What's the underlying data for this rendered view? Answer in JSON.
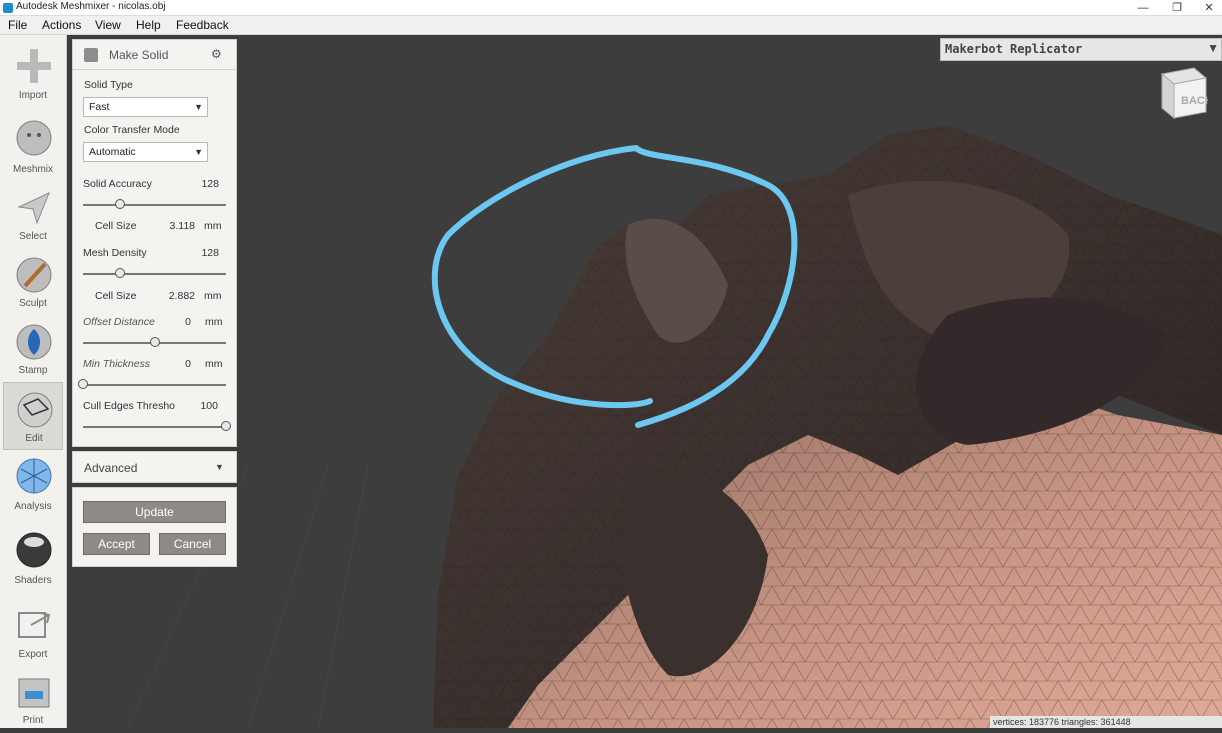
{
  "window": {
    "title": "Autodesk Meshmixer - nicolas.obj",
    "minimize": "—",
    "maximize": "❐",
    "close": "✕"
  },
  "menu": [
    "File",
    "Actions",
    "View",
    "Help",
    "Feedback"
  ],
  "toolbar": [
    {
      "label": "Import",
      "icon": "plus-icon"
    },
    {
      "label": "Meshmix",
      "icon": "bunny-icon"
    },
    {
      "label": "Select",
      "icon": "arrow-cursor-icon"
    },
    {
      "label": "Sculpt",
      "icon": "brush-icon"
    },
    {
      "label": "Stamp",
      "icon": "stamp-icon"
    },
    {
      "label": "Edit",
      "icon": "edit-sphere-icon"
    },
    {
      "label": "Analysis",
      "icon": "analysis-sphere-icon"
    },
    {
      "label": "Shaders",
      "icon": "shader-sphere-icon"
    },
    {
      "label": "Export",
      "icon": "export-icon"
    },
    {
      "label": "Print",
      "icon": "printer-icon"
    }
  ],
  "panel": {
    "title": "Make Solid",
    "solid_type_label": "Solid Type",
    "solid_type_value": "Fast",
    "color_mode_label": "Color Transfer Mode",
    "color_mode_value": "Automatic",
    "solid_accuracy_label": "Solid Accuracy",
    "solid_accuracy_value": "128",
    "solid_accuracy_level": 0.26,
    "cell_size_1_label": "Cell Size",
    "cell_size_1_value": "3.118",
    "unit_mm": "mm",
    "mesh_density_label": "Mesh Density",
    "mesh_density_value": "128",
    "mesh_density_level": 0.26,
    "cell_size_2_label": "Cell Size",
    "cell_size_2_value": "2.882",
    "offset_label": "Offset Distance",
    "offset_value": "0",
    "offset_level": 0.5,
    "min_thick_label": "Min Thickness",
    "min_thick_value": "0",
    "min_thick_level": 0.0,
    "cull_label": "Cull Edges Thresho",
    "cull_value": "100",
    "cull_level": 1.0,
    "advanced_label": "Advanced",
    "update_label": "Update",
    "accept_label": "Accept",
    "cancel_label": "Cancel"
  },
  "viewport": {
    "printer": "Makerbot Replicator",
    "view_cube_label": "BACK",
    "status": "vertices: 183776 triangles: 361448"
  },
  "colors": {
    "highlight": "#6cc8f0",
    "background": "#3d3d3d"
  }
}
